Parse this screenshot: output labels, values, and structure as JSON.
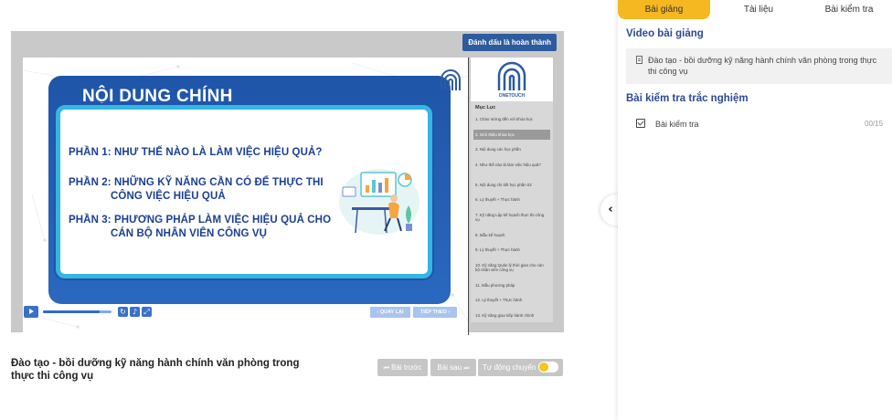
{
  "player": {
    "mark_done_label": "Đánh dấu là hoàn thành",
    "progress_fraction": 0.82,
    "slide": {
      "title": "NỘI DUNG CHÍNH",
      "lines": [
        "PHẦN 1: NHƯ THẾ NÀO LÀ LÀM VIỆC HIỆU QUẢ?",
        "PHẦN 2: NHỮNG KỸ NĂNG CẦN CÓ ĐỂ THỰC THI",
        "CÔNG VIỆC HIỆU QUẢ",
        "PHẦN 3: PHƯƠNG PHÁP LÀM VIỆC HIỆU QUẢ CHO",
        "CÁN BỘ NHÂN VIÊN CÔNG VỤ"
      ]
    },
    "side": {
      "logo_text": "ONETOUCH",
      "toc_title": "Mục Lục",
      "toc_items": [
        "1. Chào mừng đến với khóa học",
        "2. Giới thiệu khóa học",
        "3. Nội dung các học phần",
        "4. Như thế nào là làm việc hiệu quả?",
        "5. Nội dung chi tiết học phần 02",
        "6. Lý thuyết + Thực hành",
        "7. Kỹ năng Lập kế hoạch thực thi công vụ",
        "8. Mẫu kế hoạch",
        "9. Lý thuyết + Thực hành",
        "10. Kỹ năng Quản lý thời gian cho cán bộ nhân viên công vụ",
        "11. Mẫu phương pháp",
        "12. Lý thuyết + Thực hành",
        "13. Kỹ năng giao tiếp hành chính"
      ],
      "active_index": 1
    },
    "prev_label": "‹ QUAY LẠI",
    "next_label": "TIẾP THEO ›"
  },
  "lesson": {
    "title": "Đào tạo - bồi dưỡng kỹ năng hành chính văn phòng trong thực thi công vụ",
    "prev_button": "Bài trước",
    "next_button": "Bài sau",
    "auto_next_label": "Tự động chuyển",
    "auto_next_on": true
  },
  "panel": {
    "tabs": [
      "Bài giảng",
      "Tài liệu",
      "Bài kiểm tra"
    ],
    "active_tab": 0,
    "video_heading": "Video bài giảng",
    "video_item": "Đào tạo - bồi dưỡng kỹ năng hành chính văn phòng trong thực thi công vụ",
    "quiz_heading": "Bài kiểm tra trắc nghiệm",
    "quiz_item": "Bài kiểm tra",
    "quiz_score": "00/15"
  },
  "colors": {
    "accent": "#f5b820",
    "brand_blue": "#2d5b9e",
    "heading_blue": "#2a4b94"
  }
}
